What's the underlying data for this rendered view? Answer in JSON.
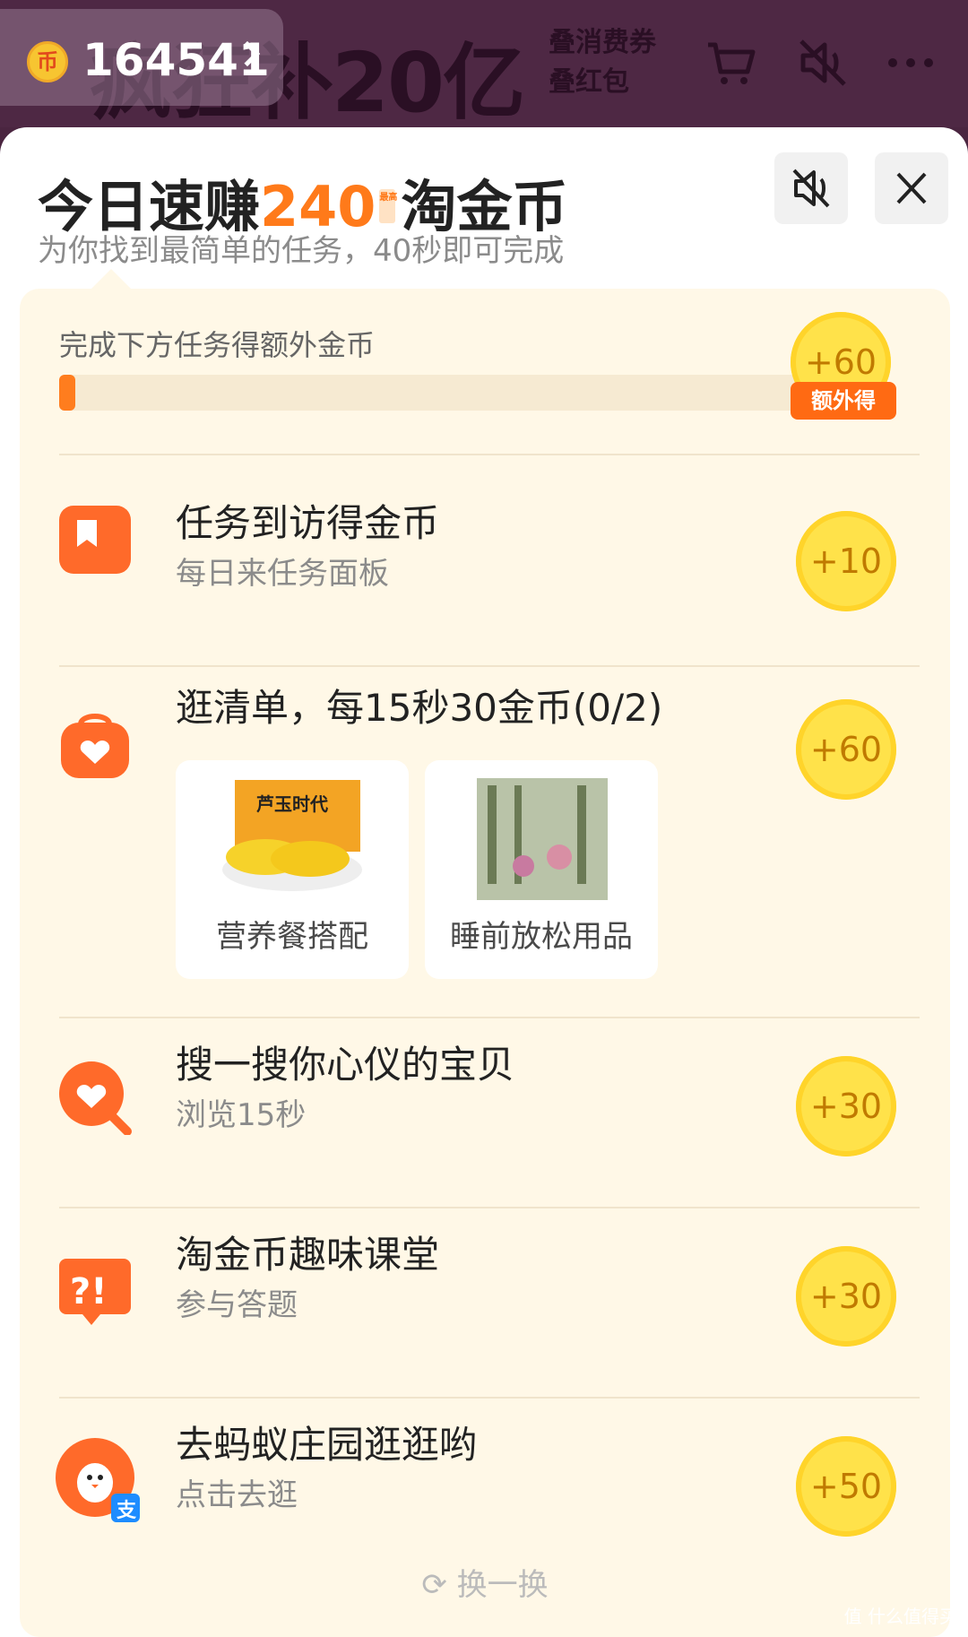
{
  "top": {
    "coin_balance": "164541",
    "coin_char": "币",
    "banner_text": "疯狂补20亿",
    "banner_side_1": "叠消费券",
    "banner_side_2": "叠红包"
  },
  "sheet": {
    "title_prefix": "今日速赚",
    "title_highlight": "240",
    "title_mini": "最高",
    "title_suffix": "淘金币",
    "subtitle": "为你找到最简单的任务，40秒即可完成"
  },
  "extra": {
    "label": "完成下方任务得额外金币",
    "reward": "+60",
    "tag": "额外得",
    "progress": 0.02
  },
  "tasks": [
    {
      "title": "任务到访得金币",
      "sub": "每日来任务面板",
      "reward": "+10",
      "icon": "bookmark-icon"
    },
    {
      "title": "逛清单，每15秒30金币(0/2)",
      "reward": "+60",
      "icon": "shopping-bag-heart-icon",
      "products": [
        {
          "label": "营养餐搭配",
          "image_text": "芦玉时代"
        },
        {
          "label": "睡前放松用品"
        }
      ]
    },
    {
      "title": "搜一搜你心仪的宝贝",
      "sub": "浏览15秒",
      "reward": "+30",
      "icon": "search-heart-icon"
    },
    {
      "title": "淘金币趣味课堂",
      "sub": "参与答题",
      "reward": "+30",
      "icon": "quiz-icon"
    },
    {
      "title": "去蚂蚁庄园逛逛哟",
      "sub": "点击去逛",
      "reward": "+50",
      "icon": "ant-farm-chick-icon",
      "badge": "支"
    }
  ],
  "refresh_label": "换一换",
  "watermark": "值 什么值得买"
}
